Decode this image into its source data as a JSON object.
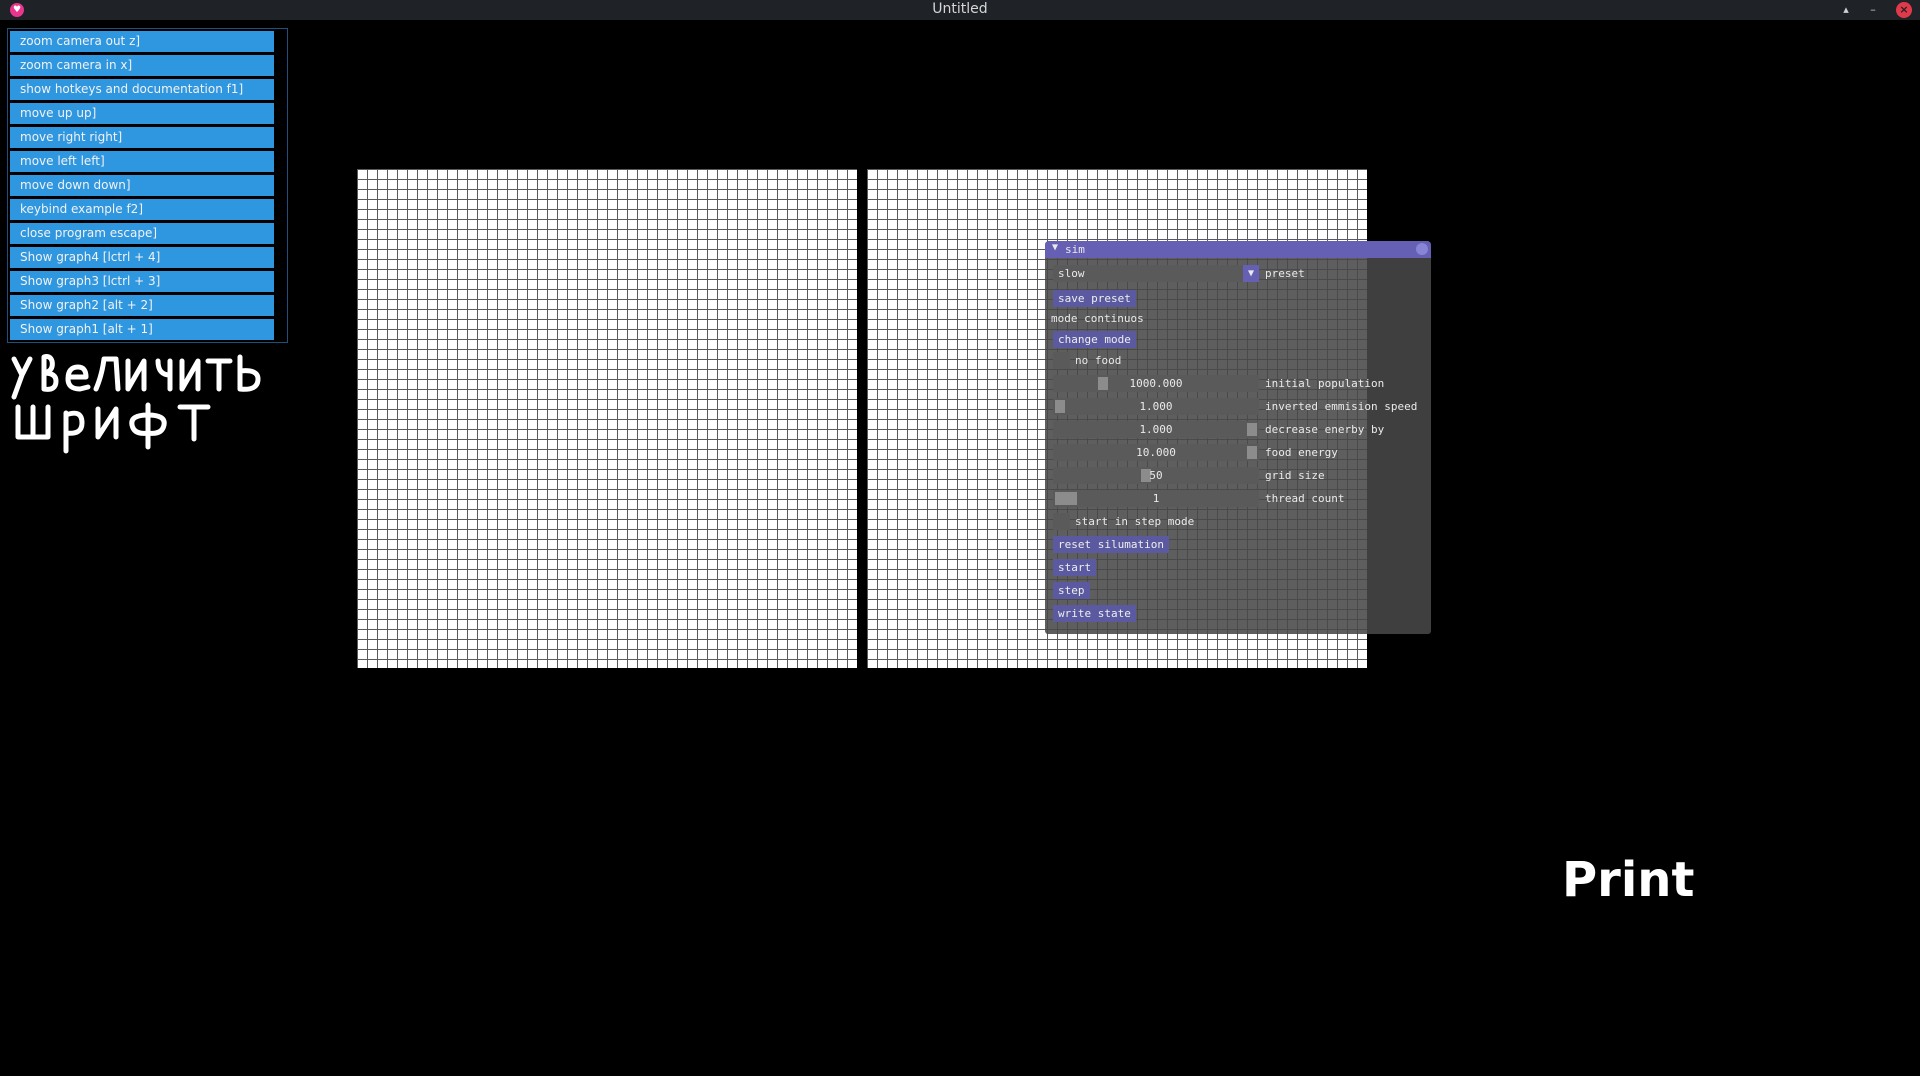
{
  "window": {
    "title": "Untitled",
    "buttons": {
      "up_icon": "▴",
      "minimize_icon": "–",
      "close_icon": "×"
    }
  },
  "hotkeys": [
    {
      "label": "zoom camera out z]"
    },
    {
      "label": "zoom camera in x]"
    },
    {
      "label": "show hotkeys and documentation f1]"
    },
    {
      "label": "move up up]"
    },
    {
      "label": "move right right]"
    },
    {
      "label": "move left left]"
    },
    {
      "label": "move down down]"
    },
    {
      "label": "keybind example f2]"
    },
    {
      "label": "close program escape]"
    },
    {
      "label": "Show graph4 [lctrl + 4]"
    },
    {
      "label": "Show graph3 [lctrl + 3]"
    },
    {
      "label": "Show graph2 [alt + 2]"
    },
    {
      "label": "Show graph1 [alt + 1]"
    }
  ],
  "handwriting": {
    "line1": "увеличить",
    "line2": "шрифт"
  },
  "sim": {
    "title": "sim",
    "collapse_icon": "▼",
    "preset_value": "slow",
    "preset_label": "preset",
    "save_preset": "save preset",
    "mode_text": "mode continuos",
    "change_mode": "change mode",
    "no_food_label": "no food",
    "initial_population": {
      "value": "1000.000",
      "label": "initial population"
    },
    "inverted_emmision_speed": {
      "value": "1.000",
      "label": "inverted emmision speed"
    },
    "decrease_enerby_by": {
      "value": "1.000",
      "label": "decrease enerby by"
    },
    "food_energy": {
      "value": "10.000",
      "label": "food energy"
    },
    "grid_size": {
      "value": "50",
      "label": "grid size"
    },
    "thread_count": {
      "value": "1",
      "label": "thread count"
    },
    "step_mode_label": "start in step mode",
    "reset": "reset silumation",
    "start": "start",
    "step": "step",
    "write_state": "write state"
  },
  "print_label": "Print",
  "colors": {
    "menu_item": "#2f96e0",
    "sim_header": "#6560b4",
    "sim_button": "#5b5aa0",
    "close_button": "#e0394a"
  }
}
